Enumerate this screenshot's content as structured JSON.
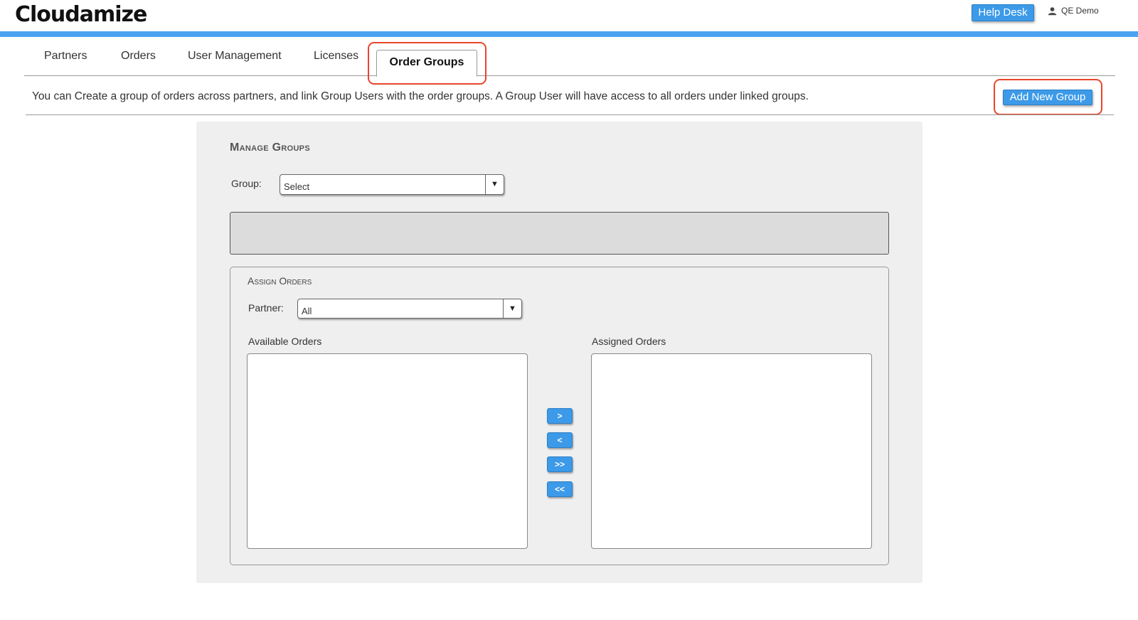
{
  "header": {
    "logo_text": "Cloudamize",
    "logo_tm": "™",
    "help_desk_label": "Help Desk",
    "user_name": "QE Demo"
  },
  "tabs": [
    {
      "label": "Partners"
    },
    {
      "label": "Orders"
    },
    {
      "label": "User Management"
    },
    {
      "label": "Licenses"
    },
    {
      "label": "Order Groups",
      "active": true
    }
  ],
  "info_text": "You can Create a group of orders across partners, and link Group Users with the order groups. A Group User will have access to all orders under linked groups.",
  "add_group_label": "Add New Group",
  "manage": {
    "title": "Manage Groups",
    "group_label": "Group:",
    "group_select_value": "Select"
  },
  "assign": {
    "title": "Assign Orders",
    "partner_label": "Partner:",
    "partner_select_value": "All",
    "available_label": "Available Orders",
    "assigned_label": "Assigned Orders",
    "move_right": ">",
    "move_left": "<",
    "move_all_right": ">>",
    "move_all_left": "<<"
  },
  "icons": {
    "dropdown_arrow": "▼",
    "user": "user-icon"
  },
  "colors": {
    "accent": "#4ba3f0",
    "button": "#3c9ae8",
    "highlight": "#e8452c"
  }
}
